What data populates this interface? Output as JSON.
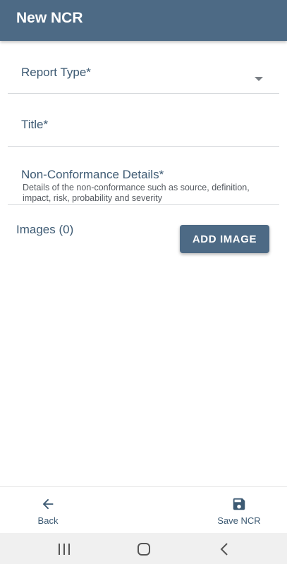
{
  "app_bar": {
    "title": "New NCR"
  },
  "form": {
    "report_type_label": "Report Type*",
    "title_label": "Title*",
    "details_label": "Non-Conformance Details*",
    "details_hint": "Details of the non-conformance such as source, definition, impact, risk, probability and severity"
  },
  "images": {
    "label": "Images (0)",
    "add_button": "ADD IMAGE"
  },
  "bottom_bar": {
    "back_label": "Back",
    "back_icon": "arrow-left-icon",
    "save_label": "Save NCR",
    "save_icon": "floppy-disk-icon"
  },
  "nav_bar": {
    "icons": [
      "recents-icon",
      "home-icon",
      "back-icon"
    ]
  },
  "colors": {
    "primary": "#4d6a85",
    "text": "#3d5a73",
    "divider": "#d6d9dc",
    "nav_bg": "#f0f0f0"
  }
}
